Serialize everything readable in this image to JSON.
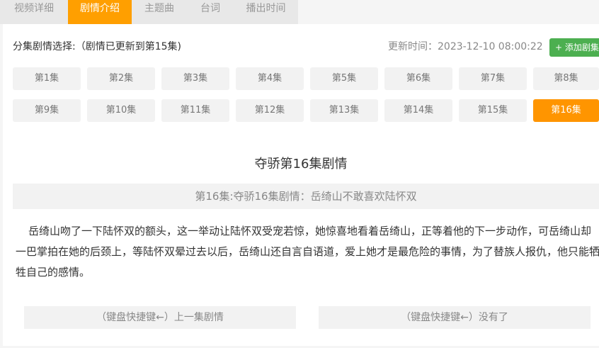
{
  "tabs": [
    {
      "label": "视频详细",
      "active": false
    },
    {
      "label": "剧情介绍",
      "active": true
    },
    {
      "label": "主题曲",
      "active": false
    },
    {
      "label": "台词",
      "active": false
    },
    {
      "label": "播出时间",
      "active": false
    }
  ],
  "header": {
    "episode_select_label": "分集剧情选择:（剧情已更新到第15集)",
    "update_time": "更新时间：2023-12-10 08:00:22",
    "add_button_label": "+ 添加剧集"
  },
  "episodes": [
    {
      "label": "第1集",
      "active": false
    },
    {
      "label": "第2集",
      "active": false
    },
    {
      "label": "第3集",
      "active": false
    },
    {
      "label": "第4集",
      "active": false
    },
    {
      "label": "第5集",
      "active": false
    },
    {
      "label": "第6集",
      "active": false
    },
    {
      "label": "第7集",
      "active": false
    },
    {
      "label": "第8集",
      "active": false
    },
    {
      "label": "第9集",
      "active": false
    },
    {
      "label": "第10集",
      "active": false
    },
    {
      "label": "第11集",
      "active": false
    },
    {
      "label": "第12集",
      "active": false
    },
    {
      "label": "第13集",
      "active": false
    },
    {
      "label": "第14集",
      "active": false
    },
    {
      "label": "第15集",
      "active": false
    },
    {
      "label": "第16集",
      "active": true
    }
  ],
  "article": {
    "title": "夺骄第16集剧情",
    "subtitle": "第16集:夺骄16集剧情：岳绮山不敢喜欢陆怀双",
    "body": "岳绮山吻了一下陆怀双的额头，这一举动让陆怀双受宠若惊，她惊喜地看着岳绮山，正等着他的下一步动作，可岳绮山却一巴掌拍在她的后颈上，等陆怀双晕过去以后，岳绮山还自言自语道，爱上她才是最危险的事情，为了替族人报仇，他只能牺牲自己的感情。"
  },
  "nav": {
    "prev_label": "（键盘快捷键←）上一集剧情",
    "next_label": "（键盘快捷键←）没有了"
  },
  "colors": {
    "accent": "#ff9f00",
    "add_button": "#4caf50"
  }
}
